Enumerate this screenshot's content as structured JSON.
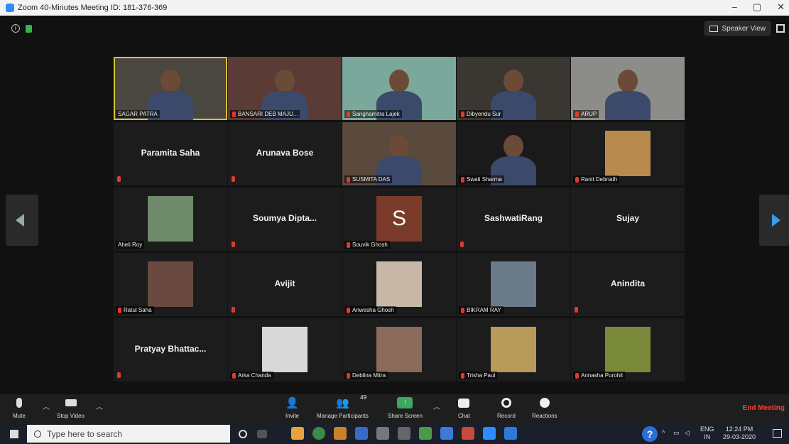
{
  "window": {
    "title": "Zoom 40-Minutes Meeting ID: 181-376-369",
    "minimize": "–",
    "maximize": "▢",
    "close": "✕"
  },
  "top": {
    "speaker_view_label": "Speaker View"
  },
  "participants": [
    {
      "name": "SAGAR PATRA",
      "type": "video",
      "bg": "#4a4640",
      "active": true
    },
    {
      "name": "BANSARI DEB MAJU...",
      "type": "video",
      "bg": "#5a3b36",
      "muted": true
    },
    {
      "name": "Sanghamitra Lajek",
      "type": "video",
      "bg": "#7aa89a",
      "muted": true
    },
    {
      "name": "Dibyendu Sur",
      "type": "video",
      "bg": "#3a3632",
      "muted": true
    },
    {
      "name": "ARUP",
      "type": "video",
      "bg": "#8c8c88",
      "muted": true
    },
    {
      "name": "Paramita Saha",
      "type": "name",
      "muted": true
    },
    {
      "name": "Arunava Bose",
      "type": "name",
      "muted": true
    },
    {
      "name": "SUSMITA DAS",
      "type": "video",
      "bg": "#5a4a3e",
      "muted": true
    },
    {
      "name": "Swati Sharma",
      "type": "video",
      "bg": "#1a1a1a",
      "muted": true
    },
    {
      "name": "Ranit Debnath",
      "type": "photo",
      "bg": "#b88a4e",
      "muted": true
    },
    {
      "name": "Aheli Roy",
      "type": "photo",
      "bg": "#6e8a6a"
    },
    {
      "name": "Soumya Dipta...",
      "type": "name",
      "muted": true
    },
    {
      "name": "Souvik Ghosh",
      "type": "initial",
      "initial": "S",
      "muted": true
    },
    {
      "name": "SashwatiRang",
      "type": "name",
      "muted": true
    },
    {
      "name": "Sujay",
      "type": "name"
    },
    {
      "name": "Ratul Saha",
      "type": "photo",
      "bg": "#6a4a40",
      "muted": true
    },
    {
      "name": "Avijit",
      "type": "name",
      "muted": true
    },
    {
      "name": "Anwesha Ghosh",
      "type": "photo",
      "bg": "#c8b8a8",
      "muted": true
    },
    {
      "name": "BIKRAM RAY",
      "type": "photo",
      "bg": "#6a7a88",
      "muted": true
    },
    {
      "name": "Anindita",
      "type": "name",
      "muted": true
    },
    {
      "name": "Pratyay Bhattac...",
      "type": "name",
      "muted": true
    },
    {
      "name": "Arka Chanda",
      "type": "photo",
      "bg": "#d8d8d8",
      "muted": true
    },
    {
      "name": "Deblina Mitra",
      "type": "photo",
      "bg": "#8a6a5a",
      "muted": true
    },
    {
      "name": "Trisha Paul",
      "type": "photo",
      "bg": "#b89a5a",
      "muted": true
    },
    {
      "name": "Annasha Purohit",
      "type": "photo",
      "bg": "#7a8a3a",
      "muted": true
    }
  ],
  "toolbar": {
    "mute": "Mute",
    "stop_video": "Stop Video",
    "invite": "Invite",
    "manage_participants": "Manage Participants",
    "participant_count": "49",
    "share_screen": "Share Screen",
    "chat": "Chat",
    "record": "Record",
    "reactions": "Reactions",
    "end_meeting": "End Meeting"
  },
  "taskbar": {
    "search_placeholder": "Type here to search",
    "language": "ENG",
    "region": "IN",
    "time": "12:24 PM",
    "date": "29-03-2020"
  }
}
